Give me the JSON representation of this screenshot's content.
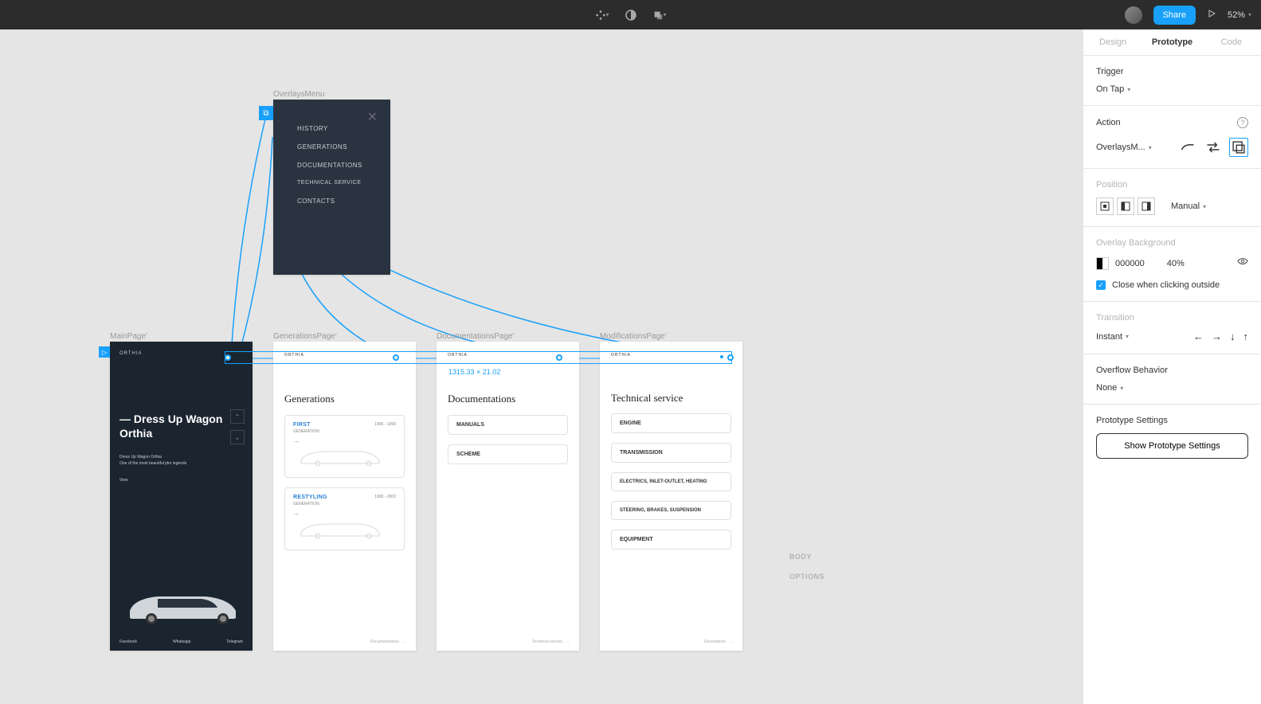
{
  "toolbar": {
    "share_label": "Share",
    "zoom": "52%"
  },
  "tabs": {
    "design": "Design",
    "prototype": "Prototype",
    "code": "Code"
  },
  "trigger": {
    "label": "Trigger",
    "value": "On Tap"
  },
  "action": {
    "label": "Action",
    "target": "OverlaysM..."
  },
  "position": {
    "label": "Position",
    "mode": "Manual"
  },
  "overlay_bg": {
    "label": "Overlay Background",
    "hex": "000000",
    "opacity": "40%",
    "close_outside": "Close when clicking outside"
  },
  "transition": {
    "label": "Transition",
    "mode": "Instant"
  },
  "overflow": {
    "label": "Overflow Behavior",
    "mode": "None"
  },
  "proto_settings": {
    "label": "Prototype Settings",
    "button": "Show Prototype Settings"
  },
  "frames": {
    "overlays_menu": "OverlaysMenu",
    "main": "MainPage'",
    "generations": "GenerationsPage'",
    "documentations": "DocumentationsPage'",
    "modifications": "ModificationsPage'"
  },
  "menu": {
    "history": "HISTORY",
    "generations": "GENERATIONS",
    "documentations": "DOCUMENTATIONS",
    "technical": "TECHNICAL SERVICE",
    "contacts": "CONTACTS"
  },
  "mainpage": {
    "brand": "ORTHIA",
    "title": "— Dress Up Wagon Orthia",
    "sub1": "Dress Up Wagon Orthia",
    "sub2": "One of the most beautiful jdm legends",
    "view": "View",
    "footer1": "Facebook",
    "footer2": "Whatsapp",
    "footer3": "Telegram"
  },
  "generations": {
    "title": "Generations",
    "gen1_title": "FIRST",
    "gen1_sub": "GENERATION",
    "gen1_years": "1996 - 1999",
    "gen2_title": "RESTYLING",
    "gen2_sub": "GENERATION",
    "gen2_years": "1999 - 2002",
    "footer": "Documentations"
  },
  "docs": {
    "title": "Documentations",
    "item1": "MANUALS",
    "item2": "SCHEME",
    "footer": "Technical service"
  },
  "tech": {
    "title": "Technical service",
    "item1": "ENGINE",
    "item2": "TRANSMISSION",
    "item3": "ELECTRICS, INLET-OUTLET, HEATING",
    "item4": "STEERING, BRAKES, SUSPENSION",
    "item5": "EQUIPMENT",
    "footer": "Generations"
  },
  "float": {
    "body": "BODY",
    "options": "OPTIONS"
  },
  "selection_dim": "1315.33 × 21.02"
}
